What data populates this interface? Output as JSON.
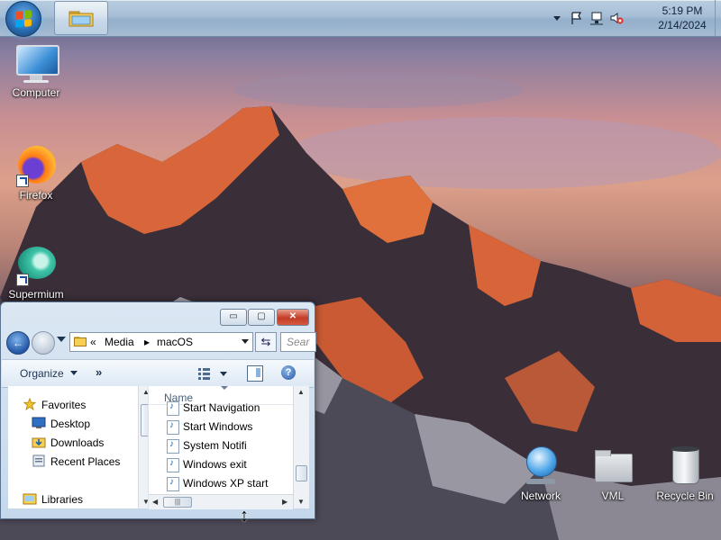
{
  "taskbar": {
    "clock_time": "5:19 PM",
    "clock_date": "2/14/2024",
    "start_icon": "windows-orb-icon",
    "pinned_app_icon": "folder-icon",
    "tray_icons": [
      "chevron-up-icon",
      "flag-icon",
      "network-icon",
      "volume-muted-icon"
    ]
  },
  "desktop": {
    "wallpaper": "mountain-sunset",
    "icons": [
      {
        "label": "Computer",
        "icon": "monitor-icon"
      },
      {
        "label": "Firefox",
        "icon": "firefox-icon"
      },
      {
        "label": "Supermium",
        "icon": "supermium-icon"
      },
      {
        "label": "Network",
        "icon": "globe-icon"
      },
      {
        "label": "VML",
        "icon": "folder-icon"
      },
      {
        "label": "Recycle Bin",
        "icon": "recycle-bin-icon"
      }
    ]
  },
  "explorer": {
    "caption_buttons": {
      "minimize": "▭",
      "maximize": "▢",
      "close": "✕"
    },
    "address": {
      "prefix": "«",
      "segment1": "Media",
      "separator": "▸",
      "segment2": "macOS"
    },
    "search_placeholder": "Sear",
    "toolbar": {
      "organize": "Organize",
      "more": "»"
    },
    "nav_pane": {
      "favorites": "Favorites",
      "desktop": "Desktop",
      "downloads": "Downloads",
      "recent_places": "Recent Places",
      "libraries": "Libraries"
    },
    "column_header": "Name",
    "files": [
      "Start Navigation",
      "Start Windows",
      "System Notifi",
      "Windows exit",
      "Windows XP start"
    ],
    "horizontal_scroll_thumb": "|||"
  },
  "colors": {
    "taskbar": "#a6bed6",
    "window_frame": "#c5d8eb",
    "accent_blue": "#2357a6",
    "close_red": "#c23a26"
  }
}
